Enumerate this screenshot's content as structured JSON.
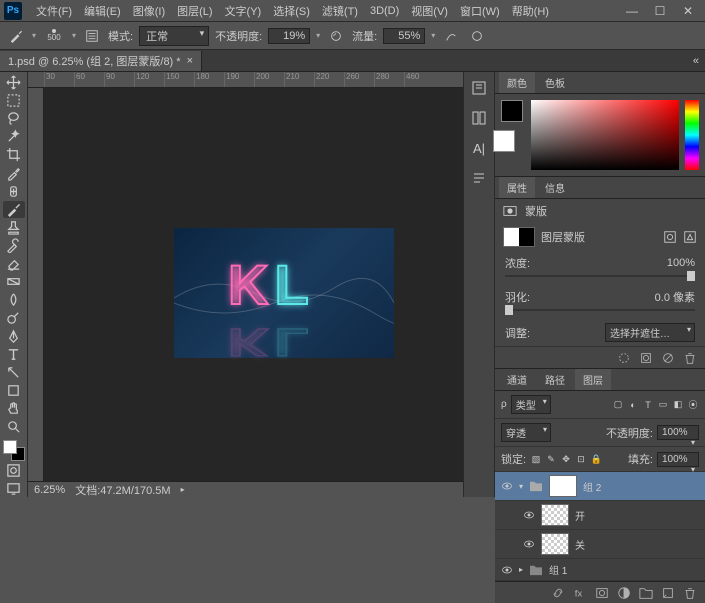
{
  "app": {
    "name": "Ps"
  },
  "menu": [
    "文件(F)",
    "编辑(E)",
    "图像(I)",
    "图层(L)",
    "文字(Y)",
    "选择(S)",
    "滤镜(T)",
    "3D(D)",
    "视图(V)",
    "窗口(W)",
    "帮助(H)"
  ],
  "options": {
    "brush_size": "500",
    "mode_label": "模式:",
    "mode_value": "正常",
    "opacity_label": "不透明度:",
    "opacity_value": "19%",
    "flow_label": "流量:",
    "flow_value": "55%"
  },
  "document": {
    "tab_title": "1.psd @ 6.25% (组 2, 图层蒙版/8) *",
    "zoom": "6.25%",
    "filesize": "文档:47.2M/170.5M"
  },
  "ruler": [
    "30",
    "60",
    "90",
    "120",
    "150",
    "180",
    "190",
    "200",
    "210",
    "220",
    "260",
    "280",
    "460"
  ],
  "panels": {
    "color_tab": "颜色",
    "swatches_tab": "色板",
    "properties_tab": "属性",
    "info_tab": "信息",
    "mask_adj": "蒙版",
    "mask_label": "图层蒙版",
    "density_label": "浓度:",
    "density_value": "100%",
    "feather_label": "羽化:",
    "feather_value": "0.0 像素",
    "refine_label": "调整:",
    "refine_btn": "选择并遮住…",
    "channels_tab": "通道",
    "paths_tab": "路径",
    "layers_tab": "图层"
  },
  "layers": {
    "kind_label": "类型",
    "blend_mode": "穿透",
    "opacity_label": "不透明度:",
    "opacity_value": "100%",
    "lock_label": "锁定:",
    "fill_label": "填充:",
    "fill_value": "100%",
    "items": [
      {
        "name": "组 2",
        "selected": true,
        "folder": true,
        "mask": true
      },
      {
        "name": "开",
        "selected": false
      },
      {
        "name": "关",
        "selected": false
      },
      {
        "name": "组 1",
        "selected": false,
        "folder": true
      }
    ]
  }
}
